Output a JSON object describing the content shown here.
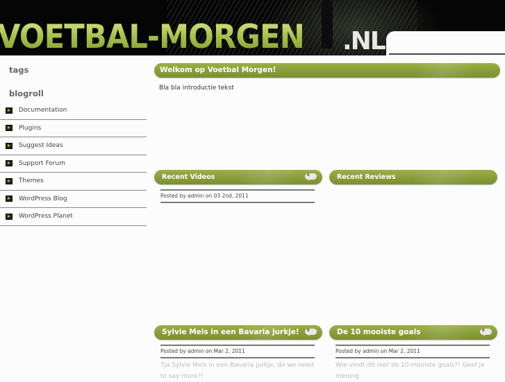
{
  "header": {
    "logo_text": "VOETBAL-MORGEN",
    "logo_tld": ".NL"
  },
  "sidebar": {
    "tags_heading": "tags",
    "blogroll_heading": "blogroll",
    "blogroll_items": [
      {
        "label": "Documentation",
        "icon": "green-arrow-bullet-icon"
      },
      {
        "label": "Plugins",
        "icon": "green-arrow-bullet-icon"
      },
      {
        "label": "Suggest Ideas",
        "icon": "green-arrow-bullet-icon"
      },
      {
        "label": "Support Forum",
        "icon": "green-arrow-bullet-icon"
      },
      {
        "label": "Themes",
        "icon": "green-arrow-bullet-icon"
      },
      {
        "label": "WordPress Blog",
        "icon": "green-arrow-bullet-icon"
      },
      {
        "label": "WordPress Planet",
        "icon": "green-arrow-bullet-icon"
      }
    ]
  },
  "main": {
    "welcome": {
      "title": "Welkom op Voetbal Morgen!",
      "text": "Bla bla introductie tekst"
    },
    "recent_videos": {
      "title": "Recent Videos",
      "comment_count": "0",
      "meta": "Posted by admin on 03 2nd, 2011"
    },
    "recent_reviews": {
      "title": "Recent Reviews"
    },
    "posts": [
      {
        "title": "Sylvie Meis in een Bavaria jurkje!",
        "comment_count": "0",
        "meta": "Posted by admin on Mar 2, 2011",
        "excerpt": "Tja Sylvie Meis in een Bavaria jurkje, do we need to say more?!"
      },
      {
        "title": "De 10 mooiste goals",
        "comment_count": "0",
        "meta": "Posted by admin on Mar 2, 2011",
        "excerpt": "Wie vindt dit niet de 10 mooiste goals?! Geef je mening"
      }
    ]
  },
  "colors": {
    "accent_green": "#8a9d38",
    "logo_green": "#a8c24a",
    "header_bg": "#050505",
    "page_bg": "#fcfcfc"
  }
}
